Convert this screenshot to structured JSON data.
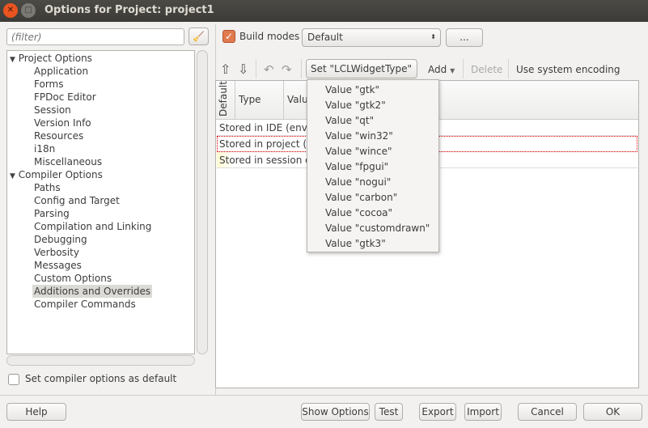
{
  "window": {
    "title": "Options for Project: project1"
  },
  "filter": {
    "placeholder": "(filter)"
  },
  "tree": {
    "groups": [
      {
        "label": "Project Options",
        "items": [
          "Application",
          "Forms",
          "FPDoc Editor",
          "Session",
          "Version Info",
          "Resources",
          "i18n",
          "Miscellaneous"
        ]
      },
      {
        "label": "Compiler Options",
        "items": [
          "Paths",
          "Config and Target",
          "Parsing",
          "Compilation and Linking",
          "Debugging",
          "Verbosity",
          "Messages",
          "Custom Options",
          "Additions and Overrides",
          "Compiler Commands"
        ]
      }
    ],
    "selected": "Additions and Overrides"
  },
  "set_default": {
    "label": "Set compiler options as default",
    "checked": false
  },
  "build_modes": {
    "label": "Build modes",
    "checked": true,
    "value": "Default",
    "more": "..."
  },
  "toolbar": {
    "set": "Set \"LCLWidgetType\"",
    "add": "Add",
    "delete": "Delete",
    "encoding": "Use system encoding"
  },
  "table": {
    "headers": [
      "Default",
      "Type",
      "Valu"
    ],
    "rows": [
      "Stored in IDE (envir",
      "Stored in project (.lp",
      "Stored in session of"
    ]
  },
  "popup": {
    "items": [
      "Value \"gtk\"",
      "Value \"gtk2\"",
      "Value \"qt\"",
      "Value \"win32\"",
      "Value \"wince\"",
      "Value \"fpgui\"",
      "Value \"nogui\"",
      "Value \"carbon\"",
      "Value \"cocoa\"",
      "Value \"customdrawn\"",
      "Value \"gtk3\""
    ]
  },
  "buttons": {
    "help": "Help",
    "show_options": "Show Options",
    "test": "Test",
    "export": "Export",
    "import": "Import",
    "cancel": "Cancel",
    "ok": "OK"
  },
  "colors": {
    "titlebar": "#3c3b37",
    "close": "#e95420",
    "checkbox": "#e07a4f"
  }
}
